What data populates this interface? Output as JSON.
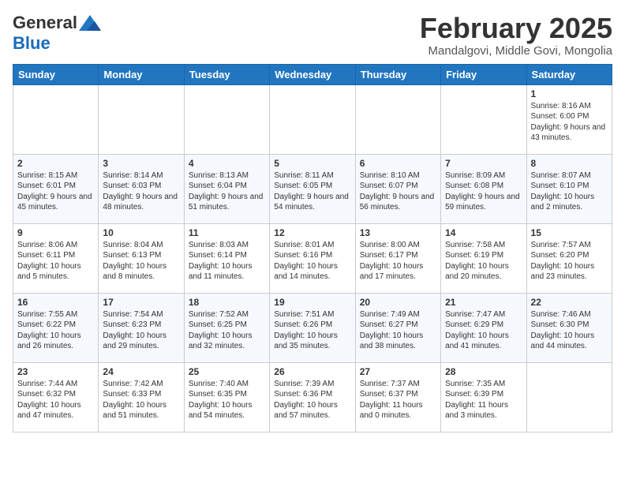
{
  "logo": {
    "general": "General",
    "blue": "Blue"
  },
  "title": {
    "month": "February 2025",
    "location": "Mandalgovi, Middle Govi, Mongolia"
  },
  "weekdays": [
    "Sunday",
    "Monday",
    "Tuesday",
    "Wednesday",
    "Thursday",
    "Friday",
    "Saturday"
  ],
  "weeks": [
    [
      {
        "day": "",
        "info": ""
      },
      {
        "day": "",
        "info": ""
      },
      {
        "day": "",
        "info": ""
      },
      {
        "day": "",
        "info": ""
      },
      {
        "day": "",
        "info": ""
      },
      {
        "day": "",
        "info": ""
      },
      {
        "day": "1",
        "info": "Sunrise: 8:16 AM\nSunset: 6:00 PM\nDaylight: 9 hours and 43 minutes."
      }
    ],
    [
      {
        "day": "2",
        "info": "Sunrise: 8:15 AM\nSunset: 6:01 PM\nDaylight: 9 hours and 45 minutes."
      },
      {
        "day": "3",
        "info": "Sunrise: 8:14 AM\nSunset: 6:03 PM\nDaylight: 9 hours and 48 minutes."
      },
      {
        "day": "4",
        "info": "Sunrise: 8:13 AM\nSunset: 6:04 PM\nDaylight: 9 hours and 51 minutes."
      },
      {
        "day": "5",
        "info": "Sunrise: 8:11 AM\nSunset: 6:05 PM\nDaylight: 9 hours and 54 minutes."
      },
      {
        "day": "6",
        "info": "Sunrise: 8:10 AM\nSunset: 6:07 PM\nDaylight: 9 hours and 56 minutes."
      },
      {
        "day": "7",
        "info": "Sunrise: 8:09 AM\nSunset: 6:08 PM\nDaylight: 9 hours and 59 minutes."
      },
      {
        "day": "8",
        "info": "Sunrise: 8:07 AM\nSunset: 6:10 PM\nDaylight: 10 hours and 2 minutes."
      }
    ],
    [
      {
        "day": "9",
        "info": "Sunrise: 8:06 AM\nSunset: 6:11 PM\nDaylight: 10 hours and 5 minutes."
      },
      {
        "day": "10",
        "info": "Sunrise: 8:04 AM\nSunset: 6:13 PM\nDaylight: 10 hours and 8 minutes."
      },
      {
        "day": "11",
        "info": "Sunrise: 8:03 AM\nSunset: 6:14 PM\nDaylight: 10 hours and 11 minutes."
      },
      {
        "day": "12",
        "info": "Sunrise: 8:01 AM\nSunset: 6:16 PM\nDaylight: 10 hours and 14 minutes."
      },
      {
        "day": "13",
        "info": "Sunrise: 8:00 AM\nSunset: 6:17 PM\nDaylight: 10 hours and 17 minutes."
      },
      {
        "day": "14",
        "info": "Sunrise: 7:58 AM\nSunset: 6:19 PM\nDaylight: 10 hours and 20 minutes."
      },
      {
        "day": "15",
        "info": "Sunrise: 7:57 AM\nSunset: 6:20 PM\nDaylight: 10 hours and 23 minutes."
      }
    ],
    [
      {
        "day": "16",
        "info": "Sunrise: 7:55 AM\nSunset: 6:22 PM\nDaylight: 10 hours and 26 minutes."
      },
      {
        "day": "17",
        "info": "Sunrise: 7:54 AM\nSunset: 6:23 PM\nDaylight: 10 hours and 29 minutes."
      },
      {
        "day": "18",
        "info": "Sunrise: 7:52 AM\nSunset: 6:25 PM\nDaylight: 10 hours and 32 minutes."
      },
      {
        "day": "19",
        "info": "Sunrise: 7:51 AM\nSunset: 6:26 PM\nDaylight: 10 hours and 35 minutes."
      },
      {
        "day": "20",
        "info": "Sunrise: 7:49 AM\nSunset: 6:27 PM\nDaylight: 10 hours and 38 minutes."
      },
      {
        "day": "21",
        "info": "Sunrise: 7:47 AM\nSunset: 6:29 PM\nDaylight: 10 hours and 41 minutes."
      },
      {
        "day": "22",
        "info": "Sunrise: 7:46 AM\nSunset: 6:30 PM\nDaylight: 10 hours and 44 minutes."
      }
    ],
    [
      {
        "day": "23",
        "info": "Sunrise: 7:44 AM\nSunset: 6:32 PM\nDaylight: 10 hours and 47 minutes."
      },
      {
        "day": "24",
        "info": "Sunrise: 7:42 AM\nSunset: 6:33 PM\nDaylight: 10 hours and 51 minutes."
      },
      {
        "day": "25",
        "info": "Sunrise: 7:40 AM\nSunset: 6:35 PM\nDaylight: 10 hours and 54 minutes."
      },
      {
        "day": "26",
        "info": "Sunrise: 7:39 AM\nSunset: 6:36 PM\nDaylight: 10 hours and 57 minutes."
      },
      {
        "day": "27",
        "info": "Sunrise: 7:37 AM\nSunset: 6:37 PM\nDaylight: 11 hours and 0 minutes."
      },
      {
        "day": "28",
        "info": "Sunrise: 7:35 AM\nSunset: 6:39 PM\nDaylight: 11 hours and 3 minutes."
      },
      {
        "day": "",
        "info": ""
      }
    ]
  ]
}
